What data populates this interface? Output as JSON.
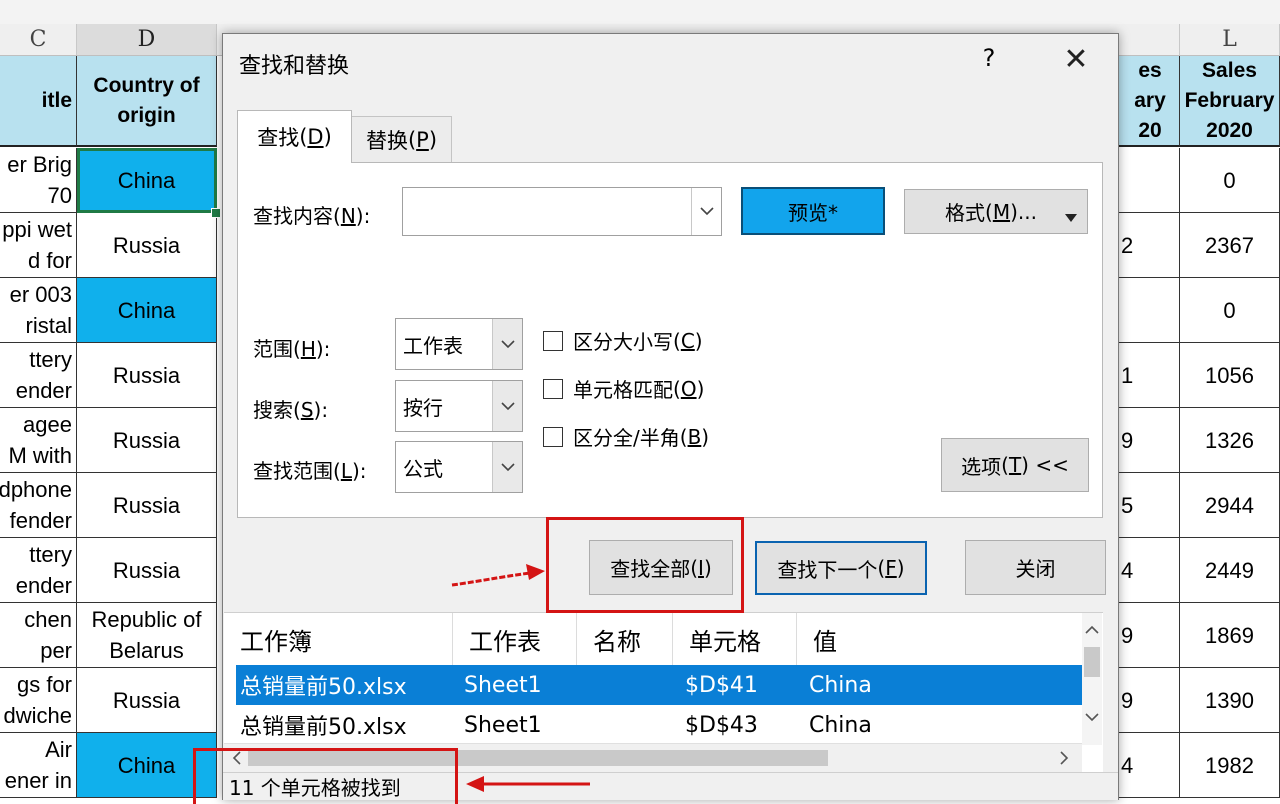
{
  "sheet": {
    "columns": [
      "C",
      "D",
      "L"
    ],
    "headers": {
      "c": "itle",
      "d": "Country of origin",
      "k": "es ary 20",
      "l": "Sales February 2020"
    },
    "rows": [
      {
        "c": "er Brig\n70",
        "d": "China",
        "k": "",
        "l": "0"
      },
      {
        "c": "ppi wet\nd for",
        "d": "Russia",
        "k": "2",
        "l": "2367"
      },
      {
        "c": "er 003\nristal",
        "d": "China",
        "k": "",
        "l": "0"
      },
      {
        "c": "ttery\nender",
        "d": "Russia",
        "k": "1",
        "l": "1056"
      },
      {
        "c": "agee\nM with",
        "d": "Russia",
        "k": "9",
        "l": "1326"
      },
      {
        "c": "dphone\nfender",
        "d": "Russia",
        "k": "5",
        "l": "2944"
      },
      {
        "c": "ttery\nender",
        "d": "Russia",
        "k": "4",
        "l": "2449"
      },
      {
        "c": "chen\nper",
        "d": "Republic of Belarus",
        "k": "9",
        "l": "1869"
      },
      {
        "c": "gs for\ndwiche",
        "d": "Russia",
        "k": "9",
        "l": "1390"
      },
      {
        "c": "Air\nener in",
        "d": "China",
        "k": "4",
        "l": "1982"
      }
    ]
  },
  "dialog": {
    "title": "查找和替换",
    "help_label": "?",
    "close_glyph": "✕",
    "tabs": {
      "find_text": "查找",
      "find_key": "D",
      "replace_text": "替换",
      "replace_key": "P"
    },
    "find_what": {
      "label_text": "查找内容",
      "key": "N",
      "value": ""
    },
    "preview_label": "预览*",
    "format_button": {
      "text": "格式",
      "key": "M",
      "suffix": "..."
    },
    "scope": {
      "label_text": "范围",
      "key": "H",
      "value": "工作表"
    },
    "search": {
      "label_text": "搜索",
      "key": "S",
      "value": "按行"
    },
    "look_in": {
      "label_text": "查找范围",
      "key": "L",
      "value": "公式"
    },
    "checkboxes": {
      "match_case": {
        "text": "区分大小写",
        "key": "C"
      },
      "whole_cell": {
        "text": "单元格匹配",
        "key": "O"
      },
      "width": {
        "text": "区分全/半角",
        "key": "B"
      }
    },
    "options_button": {
      "text": "选项",
      "key": "T",
      "suffix": " <<"
    },
    "find_all_button": {
      "text": "查找全部",
      "key": "I"
    },
    "find_next_button": {
      "text": "查找下一个",
      "key": "F"
    },
    "close_button": "关闭",
    "results": {
      "columns": [
        "工作簿",
        "工作表",
        "名称",
        "单元格",
        "值"
      ],
      "rows": [
        {
          "workbook": "总销量前50.xlsx",
          "sheet": "Sheet1",
          "name": "",
          "cell": "$D$41",
          "value": "China"
        },
        {
          "workbook": "总销量前50.xlsx",
          "sheet": "Sheet1",
          "name": "",
          "cell": "$D$43",
          "value": "China"
        }
      ]
    },
    "status_text": "11 个单元格被找到"
  },
  "colors": {
    "highlight": "#10b0ec",
    "header_fill": "#b8e1ef",
    "selected_row": "#0a7fd6",
    "annotation": "#d41414"
  }
}
